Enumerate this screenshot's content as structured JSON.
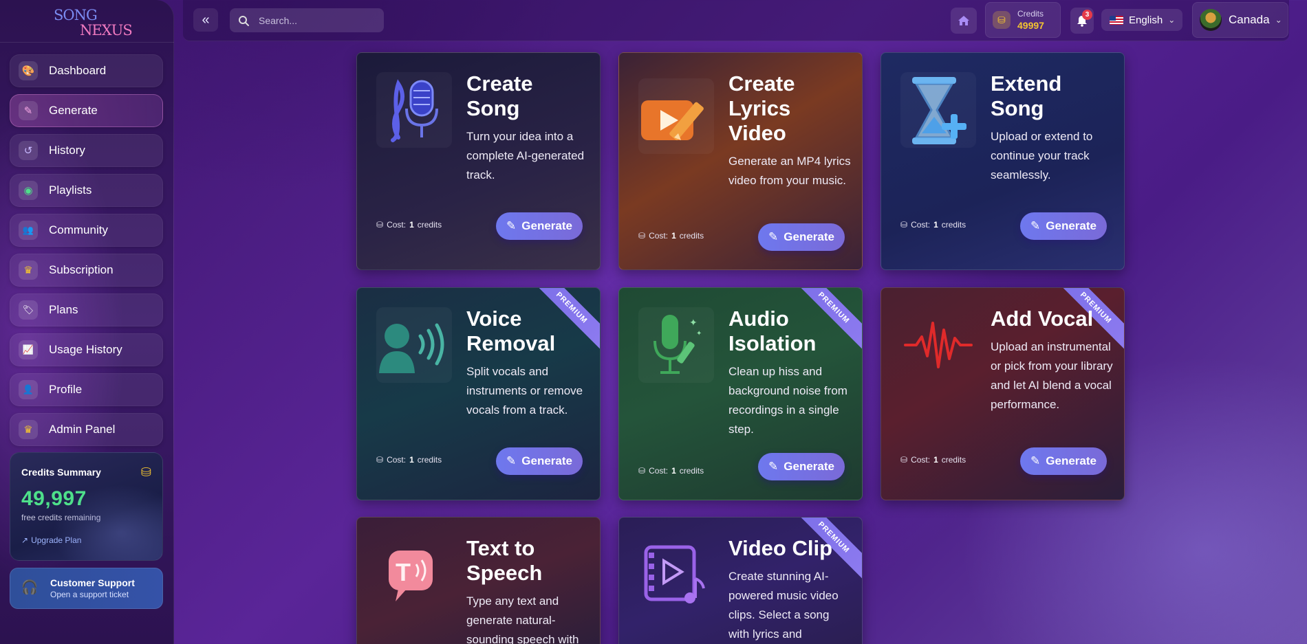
{
  "logo": {
    "line1": "SONG",
    "line2": "NEXUS"
  },
  "sidebar": {
    "items": [
      {
        "label": "Dashboard",
        "icon": "palette-icon",
        "glyph": "🎨"
      },
      {
        "label": "Generate",
        "icon": "pencil-icon",
        "glyph": "✎"
      },
      {
        "label": "History",
        "icon": "history-icon",
        "glyph": "↺"
      },
      {
        "label": "Playlists",
        "icon": "disc-icon",
        "glyph": "◉"
      },
      {
        "label": "Community",
        "icon": "users-icon",
        "glyph": "👥"
      },
      {
        "label": "Subscription",
        "icon": "crown-icon",
        "glyph": "♛"
      },
      {
        "label": "Plans",
        "icon": "tag-icon",
        "glyph": "🏷"
      },
      {
        "label": "Usage History",
        "icon": "chart-line-icon",
        "glyph": "📈"
      },
      {
        "label": "Profile",
        "icon": "user-icon",
        "glyph": "👤"
      },
      {
        "label": "Admin Panel",
        "icon": "crown-icon",
        "glyph": "♛"
      }
    ],
    "active_index": 1,
    "credits_summary": {
      "title": "Credits Summary",
      "value": "49,997",
      "subtitle": "free credits remaining",
      "link": "Upgrade Plan"
    },
    "support": {
      "title": "Customer Support",
      "subtitle": "Open a support ticket"
    }
  },
  "topbar": {
    "search_placeholder": "Search...",
    "credits_label": "Credits",
    "credits_value": "49997",
    "notifications_count": "3",
    "language": "English",
    "user": "Canada"
  },
  "cards": [
    {
      "title": "Create Song",
      "description": "Turn your idea into a complete AI-generated track.",
      "cost_prefix": "Cost:",
      "cost_value": "1",
      "cost_suffix": "credits",
      "button": "Generate",
      "premium": false,
      "icon": "music-microphone-icon"
    },
    {
      "title": "Create Lyrics Video",
      "description": "Generate an MP4 lyrics video from your music.",
      "cost_prefix": "Cost:",
      "cost_value": "1",
      "cost_suffix": "credits",
      "button": "Generate",
      "premium": false,
      "icon": "video-pencil-icon"
    },
    {
      "title": "Extend Song",
      "description": "Upload or extend to continue your track seamlessly.",
      "cost_prefix": "Cost:",
      "cost_value": "1",
      "cost_suffix": "credits",
      "button": "Generate",
      "premium": false,
      "icon": "hourglass-plus-icon"
    },
    {
      "title": "Voice Removal",
      "description": "Split vocals and instruments or remove vocals from a track.",
      "cost_prefix": "Cost:",
      "cost_value": "1",
      "cost_suffix": "credits",
      "button": "Generate",
      "premium": true,
      "ribbon": "PREMIUM",
      "icon": "voice-person-icon"
    },
    {
      "title": "Audio Isolation",
      "description": "Clean up hiss and background noise from recordings in a single step.",
      "cost_prefix": "Cost:",
      "cost_value": "1",
      "cost_suffix": "credits",
      "button": "Generate",
      "premium": true,
      "ribbon": "PREMIUM",
      "icon": "microphone-sparkle-icon"
    },
    {
      "title": "Add Vocal",
      "description": "Upload an instrumental or pick from your library and let AI blend a vocal performance.",
      "cost_prefix": "Cost:",
      "cost_value": "1",
      "cost_suffix": "credits",
      "button": "Generate",
      "premium": true,
      "ribbon": "PREMIUM",
      "icon": "soundwave-icon"
    },
    {
      "title": "Text to Speech",
      "description": "Type any text and generate natural-sounding speech with",
      "premium": false,
      "icon": "speech-bubble-icon"
    },
    {
      "title": "Video Clip",
      "description": "Create stunning AI-powered music video clips. Select a song with lyrics and",
      "premium": true,
      "ribbon": "PREMIUM",
      "icon": "film-music-icon"
    }
  ],
  "colors": {
    "accent": "#6e78ee",
    "credits_green": "#4ee08a",
    "gold": "#f4c430",
    "badge_red": "#e53a4a"
  }
}
